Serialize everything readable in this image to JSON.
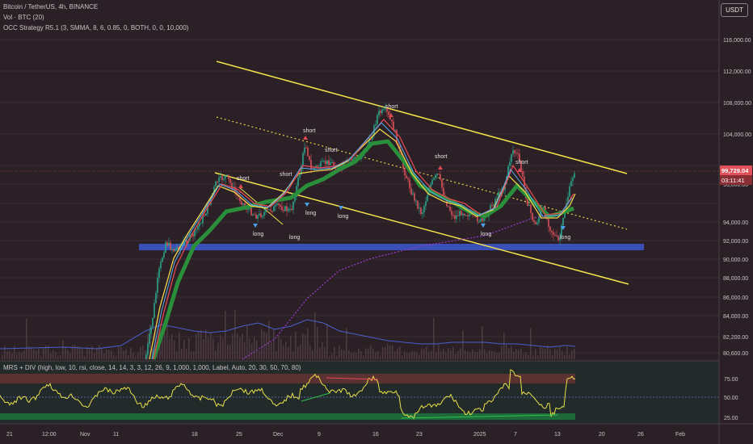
{
  "header": {
    "symbol_line": "Bitcoin / TetherUS, 4h, BINANCE",
    "volume_line": "Vol · BTC (20)",
    "strategy_line": "OCC Strategy R5.1 (3, SMMA, 8, 6, 0.85, 0, BOTH, 0, 0, 10,000)",
    "currency": "USDT"
  },
  "price_axis": {
    "ticks": [
      "116,000.00",
      "112,000.00",
      "108,000.00",
      "104,000.00",
      "96,000.00",
      "94,000.00",
      "92,000.00",
      "90,000.00",
      "88,000.00",
      "86,000.00",
      "84,000.00",
      "82,200.00",
      "80,600.00"
    ],
    "current_price": "99,729.04",
    "countdown": "03:11:41"
  },
  "oscillator": {
    "legend": "MRS + DIV (high, low, 10, rsi, close, 14, 14, 3, 3, 12, 26, 9, 1,000, 1,000, Label, Auto, 20, 30, 50, 70, 80)",
    "ticks": [
      "75.00",
      "50.00",
      "25.00"
    ]
  },
  "time_axis": {
    "labels": [
      "21",
      "12:00",
      "Nov",
      "11",
      "18",
      "25",
      "Dec",
      "9",
      "16",
      "23",
      "2025",
      "7",
      "13",
      "20",
      "26",
      "Feb"
    ]
  },
  "annotations": {
    "short": [
      "short",
      "short",
      "short",
      "short",
      "short",
      "short",
      "short"
    ],
    "long": [
      "long",
      "long",
      "long",
      "long",
      "long",
      "long"
    ]
  },
  "colors": {
    "background": "#2b2026",
    "channel": "#f2e24a",
    "support_zone": "#3a4fb8",
    "current_price": "#e0515a"
  }
}
